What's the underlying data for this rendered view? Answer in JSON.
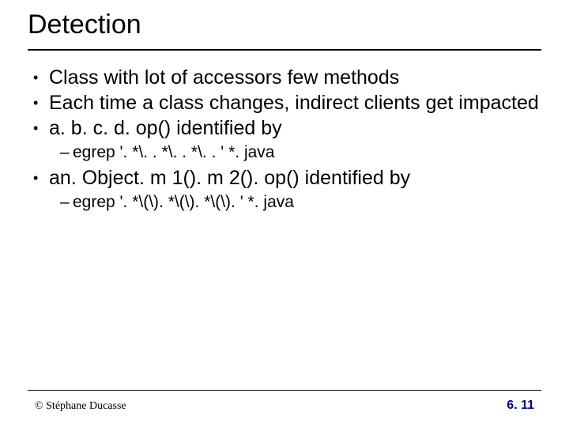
{
  "title": "Detection",
  "bullets": [
    {
      "text": "Class with lot of accessors few methods"
    },
    {
      "text": "Each time a class changes, indirect clients get impacted"
    },
    {
      "text": "a. b. c. d. op() identified by",
      "sub": [
        {
          "text": "egrep '. *\\. . *\\. . *\\. . '   *. java"
        }
      ]
    },
    {
      "text": "an. Object. m 1(). m 2(). op() identified by",
      "sub": [
        {
          "text": "egrep '. *\\(\\). *\\(\\). *\\(\\). '   *. java"
        }
      ]
    }
  ],
  "footer": {
    "left": "© Stéphane Ducasse",
    "right": "6. 11"
  }
}
